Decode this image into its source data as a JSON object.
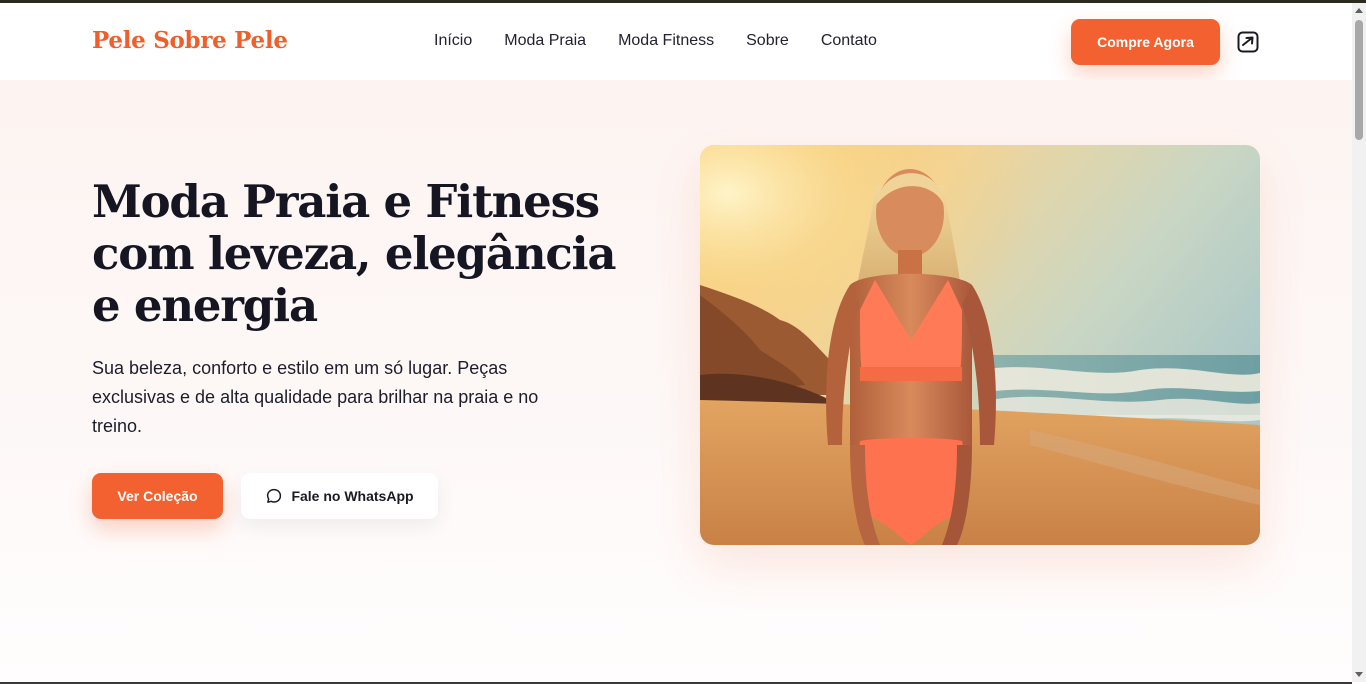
{
  "brand": {
    "name": "Pele Sobre Pele",
    "accent": "#f2612f",
    "logo_color": "#ef5f2b"
  },
  "nav": {
    "items": [
      {
        "label": "Início"
      },
      {
        "label": "Moda Praia"
      },
      {
        "label": "Moda Fitness"
      },
      {
        "label": "Sobre"
      },
      {
        "label": "Contato"
      }
    ],
    "cta_label": "Compre Agora",
    "icon": "share-icon"
  },
  "hero": {
    "title": "Moda Praia e Fitness com leveza, elegância e energia",
    "subtitle": "Sua beleza, conforto e estilo em um só lugar. Peças exclusivas e de alta qualidade para brilhar na praia e no treino.",
    "primary_button": "Ver Coleção",
    "secondary_button": "Fale no WhatsApp",
    "secondary_icon": "chat-bubble-icon",
    "image": "beach-model-photo"
  }
}
